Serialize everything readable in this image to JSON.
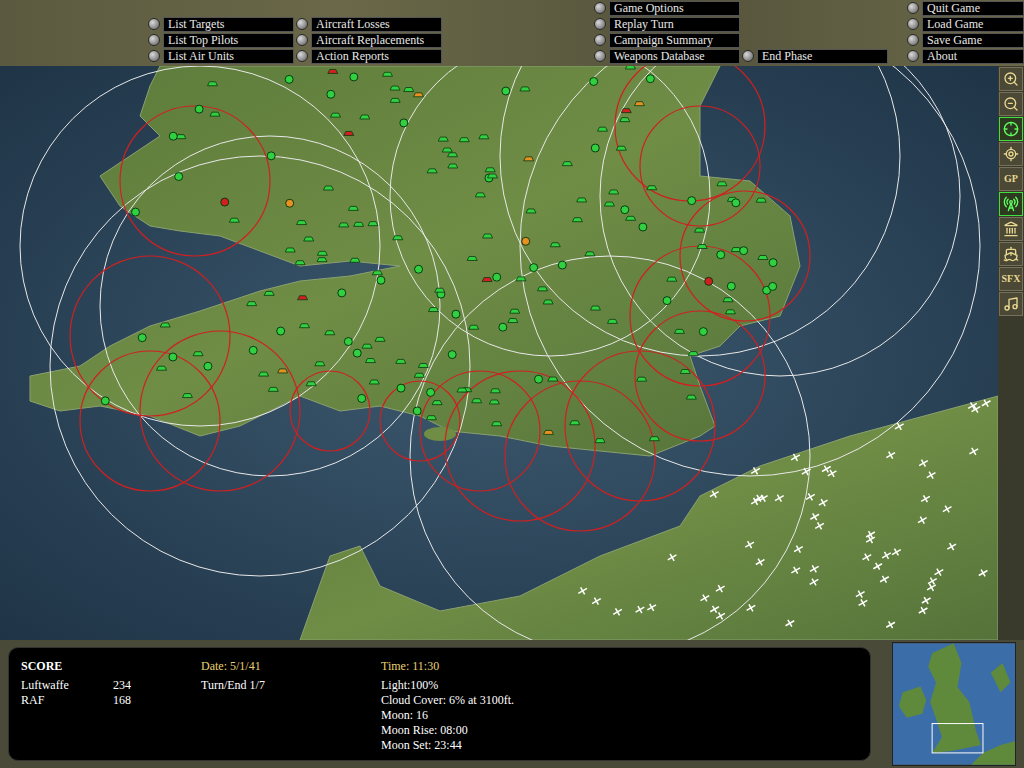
{
  "menu": {
    "left": [
      "List Targets",
      "List Top Pilots",
      "List Air Units"
    ],
    "middle": [
      "Aircraft Losses",
      "Aircraft Replacements",
      "Action Reports"
    ],
    "center": [
      "Game Options",
      "Replay Turn",
      "Campaign Summary",
      "Weapons Database"
    ],
    "phase": [
      "End Phase"
    ],
    "right": [
      "Quit Game",
      "Load Game",
      "Save Game",
      "About"
    ]
  },
  "toolbar": [
    {
      "kind": "zoom-in",
      "label": "",
      "selected": false
    },
    {
      "kind": "zoom-out",
      "label": "",
      "selected": false
    },
    {
      "kind": "target",
      "label": "",
      "selected": true
    },
    {
      "kind": "crosshair",
      "label": "",
      "selected": false
    },
    {
      "kind": "text",
      "label": "GP",
      "selected": false
    },
    {
      "kind": "radar",
      "label": "",
      "selected": true
    },
    {
      "kind": "building",
      "label": "",
      "selected": false
    },
    {
      "kind": "ship",
      "label": "",
      "selected": false
    },
    {
      "kind": "text",
      "label": "SFX",
      "selected": false
    },
    {
      "kind": "music",
      "label": "",
      "selected": false
    }
  ],
  "score": {
    "title": "SCORE",
    "rows": [
      {
        "side": "Luftwaffe",
        "points": "234"
      },
      {
        "side": "RAF",
        "points": "168"
      }
    ]
  },
  "date": "Date: 5/1/41",
  "turn": "Turn/End 1/7",
  "conditions": {
    "time": "Time: 11:30",
    "lines": [
      "Light:100%",
      "Cloud Cover: 6% at 3100ft.",
      "Moon: 16",
      "Moon Rise: 08:00",
      "Moon Set: 23:44"
    ]
  }
}
